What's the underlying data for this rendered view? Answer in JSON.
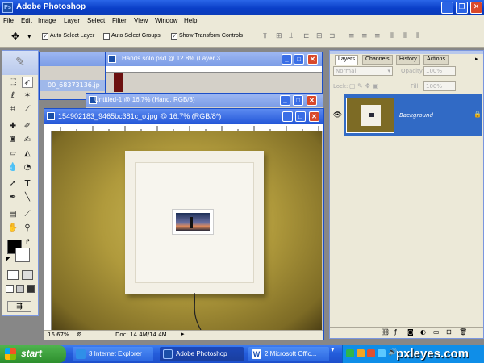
{
  "app": {
    "title": "Adobe Photoshop"
  },
  "menu": [
    "File",
    "Edit",
    "Image",
    "Layer",
    "Select",
    "Filter",
    "View",
    "Window",
    "Help"
  ],
  "options": {
    "auto_select_layer": "Auto Select Layer",
    "auto_select_groups": "Auto Select Groups",
    "show_transform_controls": "Show Transform Controls"
  },
  "documents": {
    "back": {
      "title": "4",
      "tab_text": "00_68373136.jp"
    },
    "hands": {
      "title": "Hands solo.psd @ 12.8% (Layer 3..."
    },
    "untitled": {
      "title": "Untitled-1 @ 16.7% (Hand, RGB/8)"
    },
    "main": {
      "title": "154902183_9465bc381c_o.jpg @ 16.7% (RGB/8*)",
      "zoom": "16.67%",
      "doc_info": "Doc: 14.4M/14.4M"
    }
  },
  "layers_panel": {
    "tabs": [
      "Layers",
      "Channels",
      "History",
      "Actions"
    ],
    "blend_mode": "Normal",
    "opacity_label": "Opacity:",
    "opacity_value": "100%",
    "lock_label": "Lock:",
    "fill_label": "Fill:",
    "fill_value": "100%",
    "layers": [
      {
        "name": "Background"
      }
    ]
  },
  "taskbar": {
    "start": "start",
    "tasks": [
      "3 Internet Explorer",
      "Adobe Photoshop",
      "2 Microsoft Offic..."
    ],
    "watermark": "pxleyes.com"
  },
  "colors": {
    "xp_blue": "#0a3ec8",
    "wall": "#9a8a3a",
    "start_green": "#2d8f2d",
    "close_red": "#d9482a"
  }
}
